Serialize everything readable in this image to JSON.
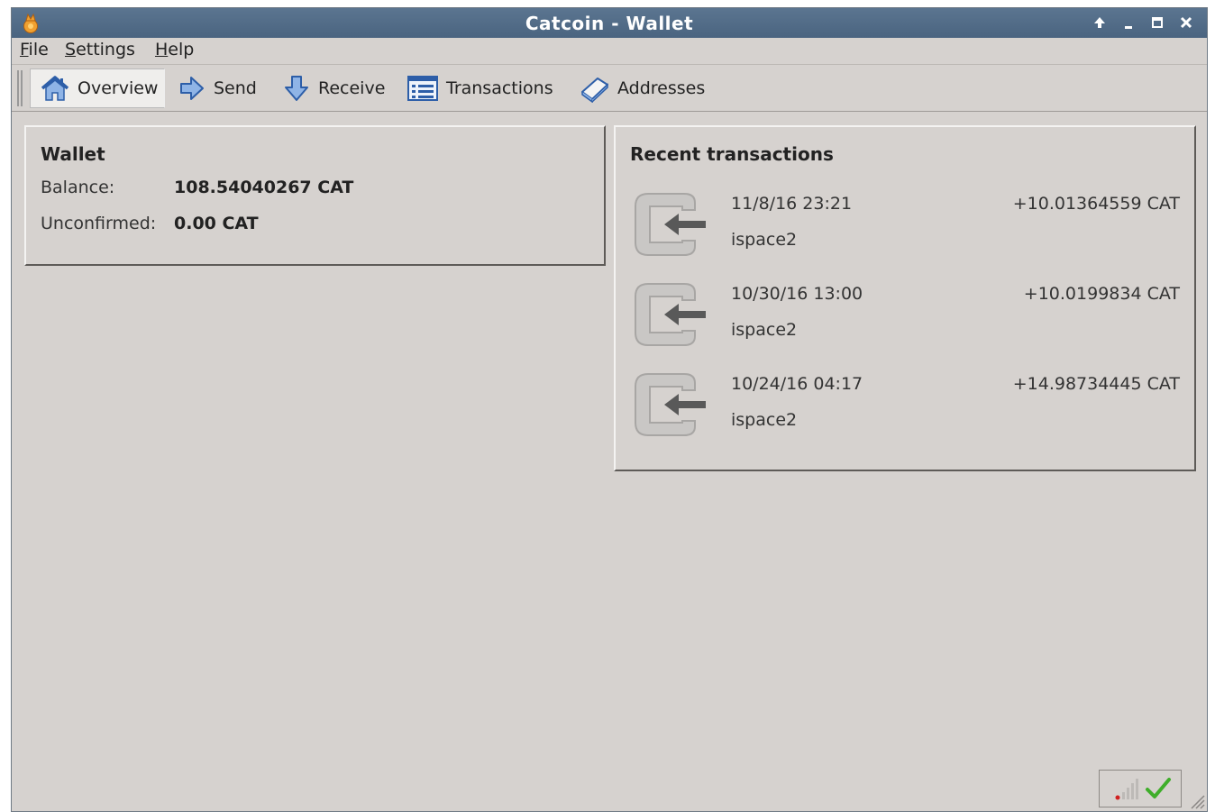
{
  "window": {
    "title": "Catcoin - Wallet",
    "app_icon": "catcoin-icon"
  },
  "title_controls": [
    "pin-up-icon",
    "minimize-icon",
    "maximize-icon",
    "close-icon"
  ],
  "menu": {
    "file": {
      "u": "F",
      "rest": "ile"
    },
    "settings": {
      "u": "S",
      "rest": "ettings"
    },
    "help": {
      "u": "H",
      "rest": "elp"
    }
  },
  "toolbar": {
    "overview": "Overview",
    "send": "Send",
    "receive": "Receive",
    "transactions": "Transactions",
    "addresses": "Addresses"
  },
  "wallet": {
    "title": "Wallet",
    "balance_label": "Balance:",
    "balance_value": "108.54040267 CAT",
    "unconfirmed_label": "Unconfirmed:",
    "unconfirmed_value": "0.00 CAT"
  },
  "recent": {
    "title": "Recent transactions",
    "items": [
      {
        "date": "11/8/16 23:21",
        "address": "ispace2",
        "amount": "+10.01364559 CAT"
      },
      {
        "date": "10/30/16 13:00",
        "address": "ispace2",
        "amount": "+10.0199834 CAT"
      },
      {
        "date": "10/24/16 04:17",
        "address": "ispace2",
        "amount": "+14.98734445 CAT"
      }
    ]
  },
  "status": {
    "icons": [
      "network-signal-icon",
      "sync-complete-check-icon"
    ]
  },
  "colors": {
    "titlebar": "#4f6984",
    "window_bg": "#d6d2cf",
    "check": "#3fae2a"
  }
}
